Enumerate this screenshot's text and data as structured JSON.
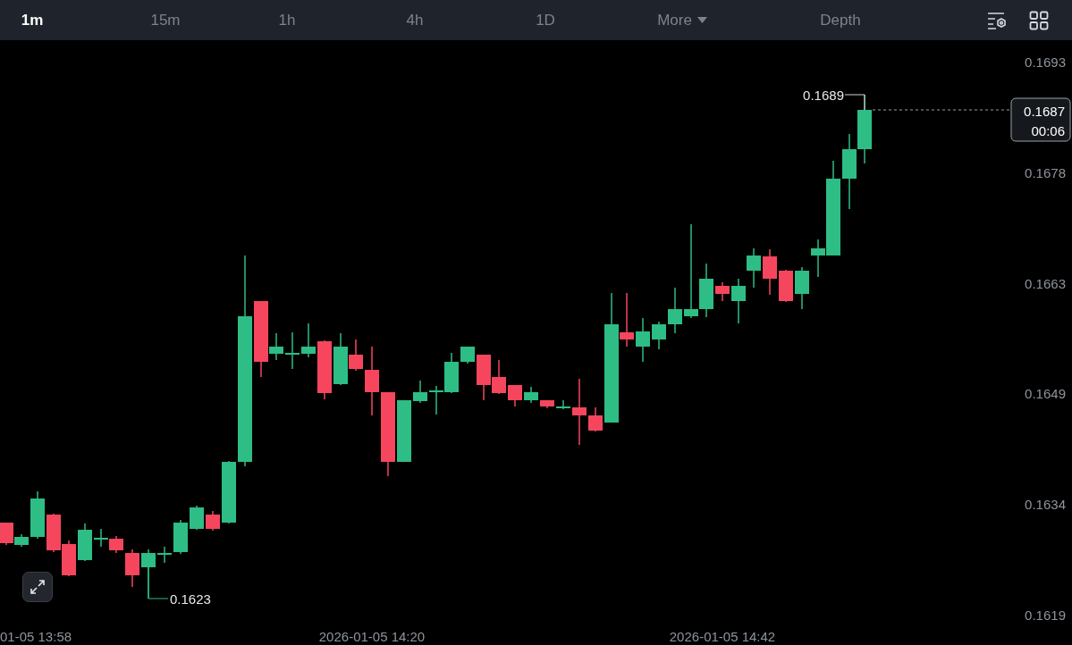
{
  "timeframe_tabs": [
    {
      "label": "1m",
      "selected": true
    },
    {
      "label": "15m",
      "selected": false
    },
    {
      "label": "1h",
      "selected": false
    },
    {
      "label": "4h",
      "selected": false
    },
    {
      "label": "1D",
      "selected": false
    }
  ],
  "more_menu": {
    "label": "More"
  },
  "depth_tab": {
    "label": "Depth",
    "selected": false
  },
  "chart": {
    "price_axis": [
      "0.1693",
      "0.1678",
      "0.1663",
      "0.1649",
      "0.1634",
      "0.1619"
    ],
    "time_axis": [
      "01-05 13:58",
      "2026-01-05 14:20",
      "2026-01-05 14:42"
    ],
    "high_marker": "0.1689",
    "low_marker": "0.1623",
    "last_price": {
      "price": "0.1687",
      "countdown": "00:06"
    }
  }
}
